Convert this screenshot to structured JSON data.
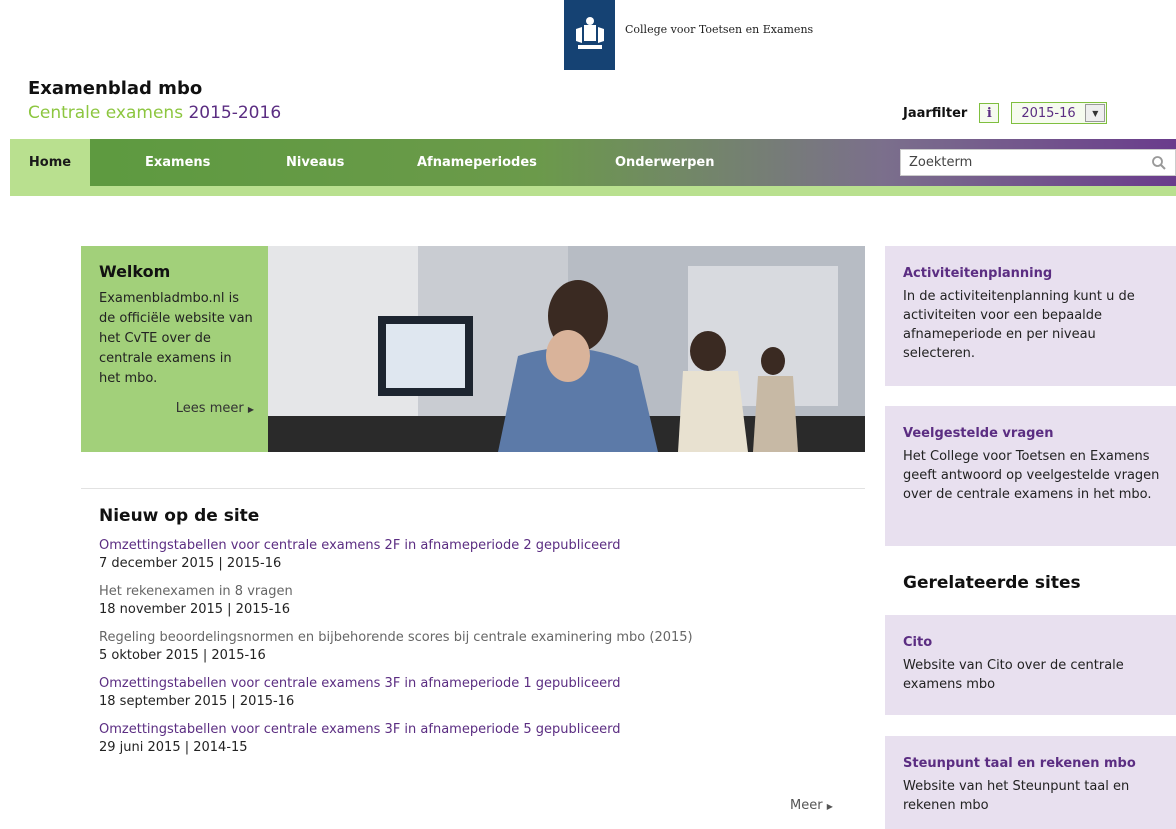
{
  "header": {
    "org_name": "College voor Toetsen en Examens",
    "site_title": "Examenblad mbo",
    "subtitle_prefix": "Centrale examens ",
    "subtitle_year": "2015-2016"
  },
  "jaarfilter": {
    "label": "Jaarfilter",
    "info_label": "i",
    "selected": "2015-16"
  },
  "nav": {
    "items": [
      "Home",
      "Examens",
      "Niveaus",
      "Afnameperiodes",
      "Onderwerpen"
    ],
    "search_placeholder": "Zoekterm"
  },
  "welcome": {
    "title": "Welkom",
    "text": "Examenbladmbo.nl is de officiële website van het CvTE over de centrale examens in het mbo.",
    "more": "Lees meer"
  },
  "news": {
    "title": "Nieuw op de site",
    "items": [
      {
        "title": "Omzettingstabellen voor centrale examens 2F in afnameperiode 2 gepubliceerd",
        "meta": "7 december 2015 | 2015-16"
      },
      {
        "title": "Het rekenexamen in 8 vragen",
        "meta": "18 november 2015 | 2015-16"
      },
      {
        "title": "Regeling beoordelingsnormen en bijbehorende scores bij centrale examinering mbo (2015)",
        "meta": "5 oktober 2015 | 2015-16"
      },
      {
        "title": "Omzettingstabellen voor centrale examens 3F in afnameperiode 1 gepubliceerd",
        "meta": "18 september 2015 | 2015-16"
      },
      {
        "title": "Omzettingstabellen voor centrale examens 3F in afnameperiode 5 gepubliceerd",
        "meta": "29 juni 2015 | 2014-15"
      }
    ],
    "more": "Meer"
  },
  "sidebar": {
    "activiteiten": {
      "title": "Activiteitenplanning",
      "text": "In de activiteitenplanning kunt u de activiteiten voor een bepaalde afnameperiode en per niveau selecteren."
    },
    "faq": {
      "title": "Veelgestelde vragen",
      "text": "Het College voor Toetsen en Examens geeft antwoord op veelgestelde vragen over de centrale examens in het mbo."
    },
    "related_title": "Gerelateerde sites",
    "cito": {
      "title": "Cito",
      "text": "Website van Cito over de centrale examens mbo"
    },
    "steunpunt": {
      "title": "Steunpunt taal en rekenen mbo",
      "text": "Website van het Steunpunt taal en rekenen mbo"
    }
  }
}
